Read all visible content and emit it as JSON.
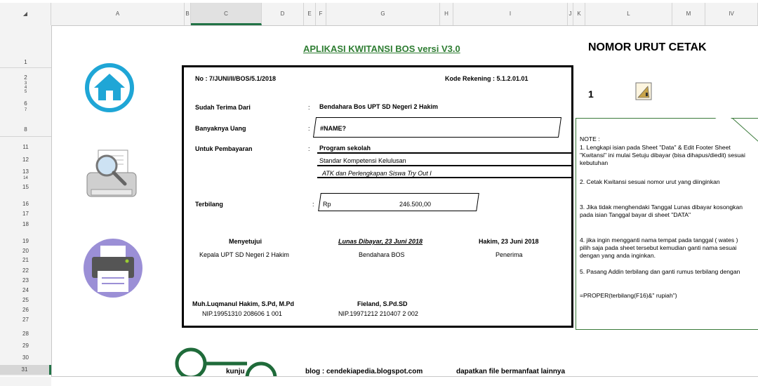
{
  "sheet": {
    "columns": [
      "A",
      "B",
      "C",
      "D",
      "E",
      "F",
      "G",
      "H",
      "I",
      "J",
      "K",
      "L",
      "M",
      "IV"
    ],
    "rows": [
      "1",
      "2",
      "3",
      "4",
      "5",
      "6",
      "7",
      "8",
      "11",
      "12",
      "13",
      "14",
      "15",
      "16",
      "17",
      "18",
      "19",
      "20",
      "21",
      "22",
      "23",
      "24",
      "25",
      "26",
      "27",
      "28",
      "29",
      "30",
      "31"
    ]
  },
  "app_title": "APLIKASI KWITANSI BOS versi V3.0",
  "nomor_urut_title": "NOMOR URUT CETAK",
  "nomor_urut_value": "1",
  "receipt": {
    "no": "No : 7/JUNI/II/BOS/5.1/2018",
    "kode_rekening": "Kode Rekening : 5.1.2.01.01",
    "sudah_terima_label": "Sudah Terima Dari",
    "sudah_terima_value": "Bendahara Bos UPT SD Negeri 2 Hakim",
    "banyaknya_label": "Banyaknya Uang",
    "banyaknya_value": "#NAME?",
    "untuk_label": "Untuk  Pembayaran",
    "untuk_line1": "Program sekolah",
    "untuk_line2": "Standar Kompetensi Kelulusan",
    "untuk_line3": "ATK dan Perlengkapan Siswa Try Out I",
    "colon": ":",
    "terbilang_label": "Terbilang",
    "rp": "Rp",
    "amount": "246.500,00",
    "menyetujui": "Menyetujui",
    "lunas": "Lunas Dibayar, 23 Juni 2018",
    "hakim_date": "Hakim, 23 Juni 2018",
    "kepala": "Kepala UPT SD Negeri 2 Hakim",
    "bendahara": "Bendahara BOS",
    "penerima": "Penerima",
    "sign1_name": "Muh.Luqmanul Hakim, S.Pd, M.Pd",
    "sign1_nip": "NIP.19951310 208606 1 001",
    "sign2_name": "Fieland, S.Pd.SD",
    "sign2_nip": "NIP.19971212 210407 2 002"
  },
  "note": {
    "heading": "NOTE :",
    "items": [
      "1. Lengkapi isian pada Sheet \"Data\" & Edit Footer Sheet \"Kwitansi\" ini mulai Setuju dibayar (bisa dihapus/diedit) sesuai kebutuhan",
      "2. Cetak Kwitansi sesuai nomor urut yang diinginkan",
      "3. Jika tidak menghendaki Tanggal Lunas dibayar kosongkan pada isian Tanggal bayar di sheet \"DATA\"",
      "4. jika ingin mengganti nama tempat pada tanggal ( wates ) pilih saja pada sheet  tersebut  kemudian ganti nama sesuai dengan yang anda inginkan.",
      "5. Pasang Addin terbilang dan ganti rumus terbilang dengan",
      "=PROPER(terbilang(F16)&\" rupiah\")"
    ]
  },
  "footer": {
    "kunjungi": "kunju",
    "blog": "blog : cendekiapedia.blogspot.com",
    "dapatkan": "dapatkan file bermanfaat lainnya"
  },
  "colors": {
    "accent_green": "#217346",
    "title_green": "#2e7d32",
    "home_blue": "#1fa6d6",
    "printer_purple": "#9b8fd6"
  }
}
